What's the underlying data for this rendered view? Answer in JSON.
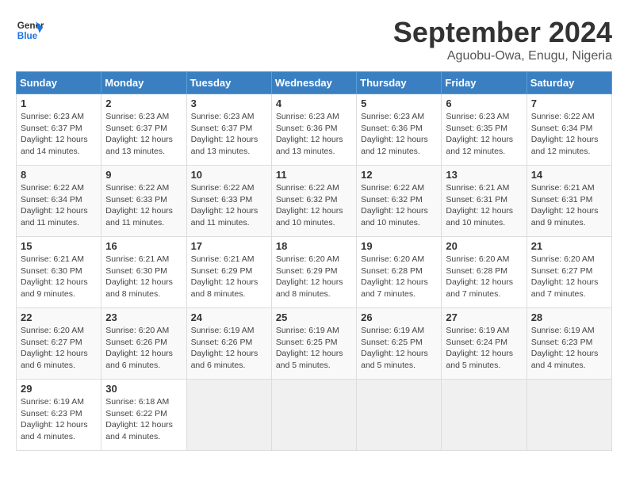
{
  "header": {
    "logo_line1": "General",
    "logo_line2": "Blue",
    "title": "September 2024",
    "subtitle": "Aguobu-Owa, Enugu, Nigeria"
  },
  "weekdays": [
    "Sunday",
    "Monday",
    "Tuesday",
    "Wednesday",
    "Thursday",
    "Friday",
    "Saturday"
  ],
  "weeks": [
    [
      {
        "day": "1",
        "sunrise": "6:23 AM",
        "sunset": "6:37 PM",
        "daylight": "12 hours and 14 minutes."
      },
      {
        "day": "2",
        "sunrise": "6:23 AM",
        "sunset": "6:37 PM",
        "daylight": "12 hours and 13 minutes."
      },
      {
        "day": "3",
        "sunrise": "6:23 AM",
        "sunset": "6:37 PM",
        "daylight": "12 hours and 13 minutes."
      },
      {
        "day": "4",
        "sunrise": "6:23 AM",
        "sunset": "6:36 PM",
        "daylight": "12 hours and 13 minutes."
      },
      {
        "day": "5",
        "sunrise": "6:23 AM",
        "sunset": "6:36 PM",
        "daylight": "12 hours and 12 minutes."
      },
      {
        "day": "6",
        "sunrise": "6:23 AM",
        "sunset": "6:35 PM",
        "daylight": "12 hours and 12 minutes."
      },
      {
        "day": "7",
        "sunrise": "6:22 AM",
        "sunset": "6:34 PM",
        "daylight": "12 hours and 12 minutes."
      }
    ],
    [
      {
        "day": "8",
        "sunrise": "6:22 AM",
        "sunset": "6:34 PM",
        "daylight": "12 hours and 11 minutes."
      },
      {
        "day": "9",
        "sunrise": "6:22 AM",
        "sunset": "6:33 PM",
        "daylight": "12 hours and 11 minutes."
      },
      {
        "day": "10",
        "sunrise": "6:22 AM",
        "sunset": "6:33 PM",
        "daylight": "12 hours and 11 minutes."
      },
      {
        "day": "11",
        "sunrise": "6:22 AM",
        "sunset": "6:32 PM",
        "daylight": "12 hours and 10 minutes."
      },
      {
        "day": "12",
        "sunrise": "6:22 AM",
        "sunset": "6:32 PM",
        "daylight": "12 hours and 10 minutes."
      },
      {
        "day": "13",
        "sunrise": "6:21 AM",
        "sunset": "6:31 PM",
        "daylight": "12 hours and 10 minutes."
      },
      {
        "day": "14",
        "sunrise": "6:21 AM",
        "sunset": "6:31 PM",
        "daylight": "12 hours and 9 minutes."
      }
    ],
    [
      {
        "day": "15",
        "sunrise": "6:21 AM",
        "sunset": "6:30 PM",
        "daylight": "12 hours and 9 minutes."
      },
      {
        "day": "16",
        "sunrise": "6:21 AM",
        "sunset": "6:30 PM",
        "daylight": "12 hours and 8 minutes."
      },
      {
        "day": "17",
        "sunrise": "6:21 AM",
        "sunset": "6:29 PM",
        "daylight": "12 hours and 8 minutes."
      },
      {
        "day": "18",
        "sunrise": "6:20 AM",
        "sunset": "6:29 PM",
        "daylight": "12 hours and 8 minutes."
      },
      {
        "day": "19",
        "sunrise": "6:20 AM",
        "sunset": "6:28 PM",
        "daylight": "12 hours and 7 minutes."
      },
      {
        "day": "20",
        "sunrise": "6:20 AM",
        "sunset": "6:28 PM",
        "daylight": "12 hours and 7 minutes."
      },
      {
        "day": "21",
        "sunrise": "6:20 AM",
        "sunset": "6:27 PM",
        "daylight": "12 hours and 7 minutes."
      }
    ],
    [
      {
        "day": "22",
        "sunrise": "6:20 AM",
        "sunset": "6:27 PM",
        "daylight": "12 hours and 6 minutes."
      },
      {
        "day": "23",
        "sunrise": "6:20 AM",
        "sunset": "6:26 PM",
        "daylight": "12 hours and 6 minutes."
      },
      {
        "day": "24",
        "sunrise": "6:19 AM",
        "sunset": "6:26 PM",
        "daylight": "12 hours and 6 minutes."
      },
      {
        "day": "25",
        "sunrise": "6:19 AM",
        "sunset": "6:25 PM",
        "daylight": "12 hours and 5 minutes."
      },
      {
        "day": "26",
        "sunrise": "6:19 AM",
        "sunset": "6:25 PM",
        "daylight": "12 hours and 5 minutes."
      },
      {
        "day": "27",
        "sunrise": "6:19 AM",
        "sunset": "6:24 PM",
        "daylight": "12 hours and 5 minutes."
      },
      {
        "day": "28",
        "sunrise": "6:19 AM",
        "sunset": "6:23 PM",
        "daylight": "12 hours and 4 minutes."
      }
    ],
    [
      {
        "day": "29",
        "sunrise": "6:19 AM",
        "sunset": "6:23 PM",
        "daylight": "12 hours and 4 minutes."
      },
      {
        "day": "30",
        "sunrise": "6:18 AM",
        "sunset": "6:22 PM",
        "daylight": "12 hours and 4 minutes."
      },
      {
        "day": "",
        "sunrise": "",
        "sunset": "",
        "daylight": ""
      },
      {
        "day": "",
        "sunrise": "",
        "sunset": "",
        "daylight": ""
      },
      {
        "day": "",
        "sunrise": "",
        "sunset": "",
        "daylight": ""
      },
      {
        "day": "",
        "sunrise": "",
        "sunset": "",
        "daylight": ""
      },
      {
        "day": "",
        "sunrise": "",
        "sunset": "",
        "daylight": ""
      }
    ]
  ],
  "labels": {
    "sunrise_prefix": "Sunrise: ",
    "sunset_prefix": "Sunset: ",
    "daylight_prefix": "Daylight: "
  }
}
